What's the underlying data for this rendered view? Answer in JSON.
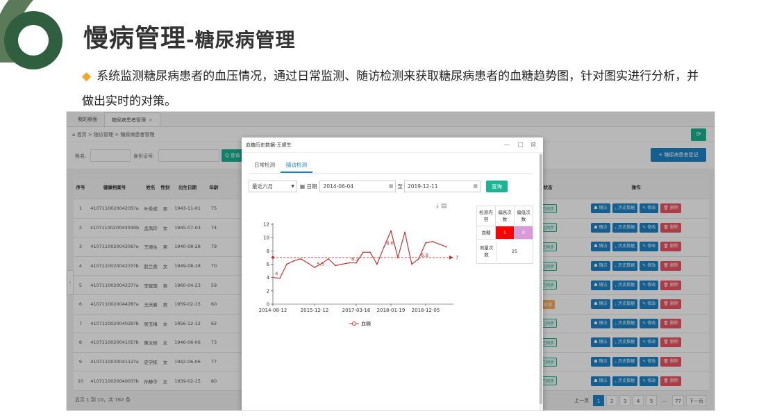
{
  "slide": {
    "title_main": "慢病管理",
    "title_sub": "-糖尿病管理",
    "description": "系统监测糖尿病患者的血压情况，通过日常监测、随访检测来获取糖尿病患者的血糖趋势图，针对图实进行分析，并做出实时的对策。"
  },
  "app": {
    "tabs": [
      {
        "label": "我的桌面"
      },
      {
        "label": "糖尿病患者管理",
        "close": "×"
      }
    ],
    "breadcrumb": "首页 > 随访管理 > 糖尿病患者管理",
    "home_icon": "home-icon",
    "filters": {
      "name_label": "姓名:",
      "idcard_label": "身份证号:",
      "query_label": "Q 查询"
    },
    "add_button": "+ 糖尿病患者登记",
    "headers": {
      "no": "序号",
      "record": "健康档案号",
      "name": "姓名",
      "sex": "性别",
      "birth": "出生日期",
      "age": "年龄",
      "status": "状态",
      "ops": "操作"
    },
    "rows": [
      {
        "no": "1",
        "record": "410711002004205?a",
        "name": "叶秀成",
        "sex": "男",
        "birth": "1943-11-01",
        "age": "75",
        "status": "已同步"
      },
      {
        "no": "2",
        "record": "4107110020043049b",
        "name": "孟凤珍",
        "sex": "女",
        "birth": "1945-07-03",
        "age": "74",
        "status": "已同步"
      },
      {
        "no": "3",
        "record": "410711002004206?e",
        "name": "王顺生",
        "sex": "男",
        "birth": "1940-08-28",
        "age": "79",
        "status": "已同步"
      },
      {
        "no": "4",
        "record": "410711002004233?b",
        "name": "赵兰香",
        "sex": "女",
        "birth": "1949-08-18",
        "age": "70",
        "status": "已同步"
      },
      {
        "no": "5",
        "record": "410711002004237?a",
        "name": "李建国",
        "sex": "男",
        "birth": "1960-04-23",
        "age": "59",
        "status": "已同步"
      },
      {
        "no": "6",
        "record": "410711002004428?a",
        "name": "王庆春",
        "sex": "男",
        "birth": "1959-02-15",
        "age": "60",
        "status": "新增"
      },
      {
        "no": "7",
        "record": "410711002004039?b",
        "name": "张玉梅",
        "sex": "女",
        "birth": "1956-12-12",
        "age": "62",
        "status": "已同步"
      },
      {
        "no": "8",
        "record": "410711002004105?b",
        "name": "黄汝娇",
        "sex": "女",
        "birth": "1946-06-06",
        "age": "73",
        "status": "已同步"
      },
      {
        "no": "9",
        "record": "410711002004112?a",
        "name": "史学栋",
        "sex": "女",
        "birth": "1942-06-06",
        "age": "77",
        "status": "已同步"
      },
      {
        "no": "10",
        "record": "410711002004003?b",
        "name": "孙静华",
        "sex": "女",
        "birth": "1939-02-15",
        "age": "80",
        "status": "已同步"
      }
    ],
    "row_ops": [
      "随访",
      "历史数据",
      "修改",
      "删除"
    ],
    "footer_text": "显示 1 到 10，共 767 条",
    "pager": {
      "prev": "上一页",
      "pages": [
        "1",
        "2",
        "3",
        "4",
        "5",
        "...",
        "77"
      ],
      "next": "下一页"
    }
  },
  "modal": {
    "title": "血糖历史数据-王顺生",
    "controls": "— □ ⊠",
    "tabs": [
      "日常检测",
      "随访检测"
    ],
    "range_select": "最近六月",
    "date_label": "日期",
    "date_from": "2014-06-04",
    "to_label": "至",
    "date_to": "2019-12-11",
    "query": "查询",
    "stat": {
      "head": [
        "检测内容",
        "偏高次数",
        "偏低次数"
      ],
      "row1": [
        "血糖",
        "1",
        "0"
      ],
      "row2": [
        "测量次数",
        "25"
      ]
    }
  },
  "chart_data": {
    "type": "line",
    "x_ticks": [
      "2014-08-12",
      "2015-12-12",
      "2017-03-16",
      "2018-01-19",
      "2018-12-05"
    ],
    "ylim": [
      0,
      12
    ],
    "y_ticks": [
      0,
      2,
      4,
      6,
      8,
      10,
      12
    ],
    "series": [
      {
        "name": "血糖",
        "values": [
          4,
          3.9,
          6.0,
          6.5,
          6.8,
          6.2,
          5.5,
          6.1,
          6.8,
          5.8,
          6.0,
          6.2,
          6.2,
          7.8,
          7.8,
          6.0,
          8.6,
          11.0,
          7.0,
          10.8,
          6.0,
          6.8,
          9.2,
          9.4,
          9.0,
          8.6
        ]
      }
    ],
    "data_labels": [
      {
        "index": 0,
        "text": "4"
      },
      {
        "index": 6,
        "text": "5.5"
      },
      {
        "index": 11,
        "text": "6.2"
      },
      {
        "index": 16,
        "text": "8.6"
      },
      {
        "index": 21,
        "text": "6.8"
      }
    ],
    "average_line": 7,
    "average_label": "7",
    "legend": "血糖",
    "color": "#c23531"
  }
}
